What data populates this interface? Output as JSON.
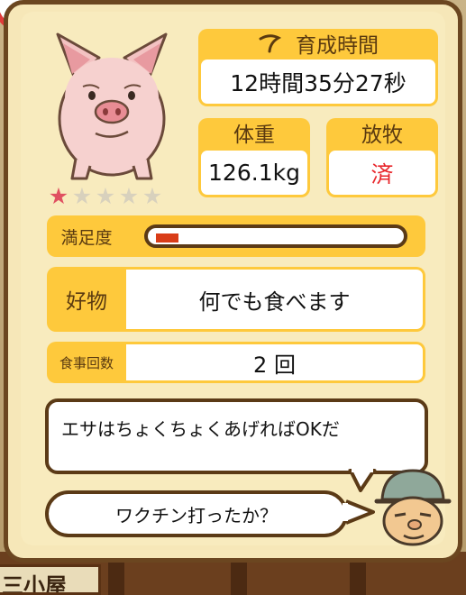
{
  "header": {
    "timer_label": "育成時間",
    "timer_value": "12時間35分27秒"
  },
  "weight": {
    "label": "体重",
    "value": "126.1kg"
  },
  "pasture": {
    "label": "放牧",
    "value": "済"
  },
  "rating": {
    "filled": 1,
    "total": 5
  },
  "satisfaction": {
    "label": "満足度",
    "level": 0.08
  },
  "favorite": {
    "label": "好物",
    "value": "何でも食べます"
  },
  "meals": {
    "label": "食事回数",
    "value": "2 回"
  },
  "dialog": {
    "line1": "エサはちょくちょくあげればOKだ",
    "line2": "ワクチン打ったか？"
  },
  "background": {
    "sign_text": "三小屋"
  },
  "colors": {
    "gold": "#fec93c",
    "frame": "#6b4620",
    "gauge": "#d93d18",
    "star": "#e05061",
    "pasture_value": "#e8262b"
  }
}
